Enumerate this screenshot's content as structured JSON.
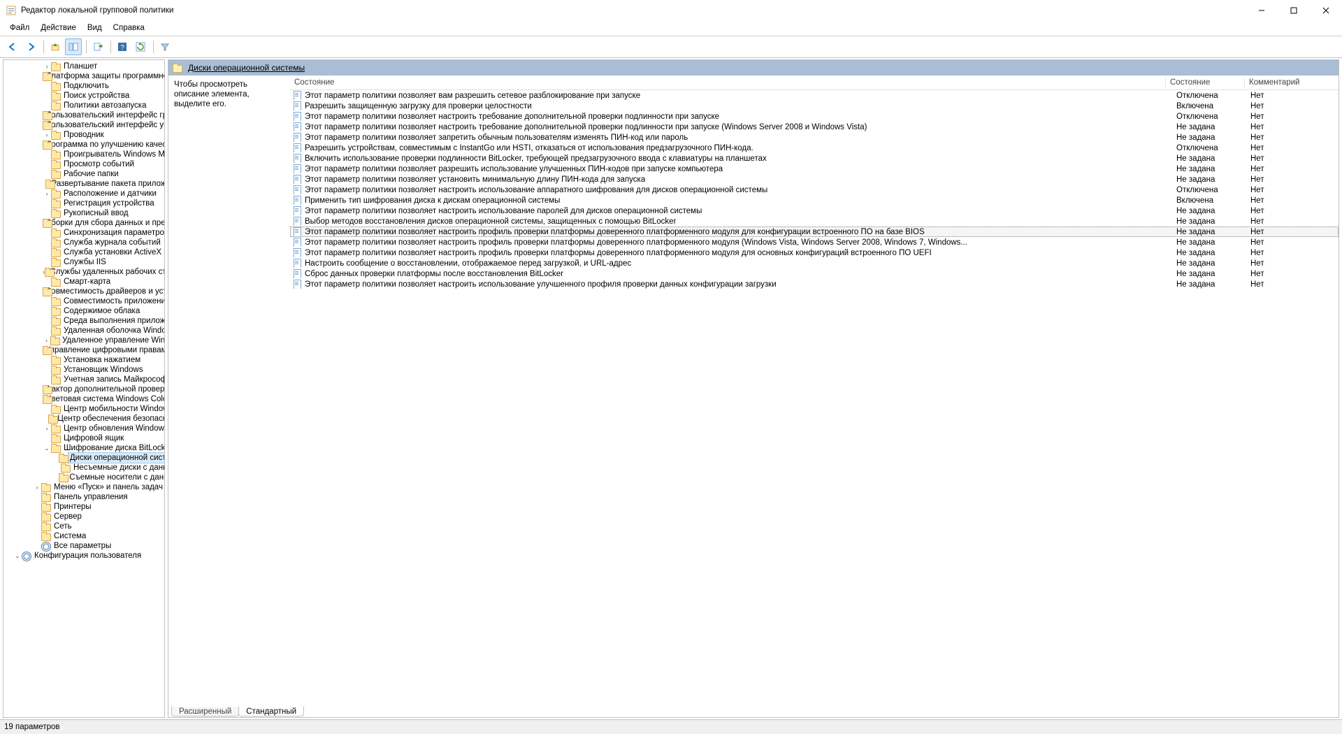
{
  "window": {
    "title": "Редактор локальной групповой политики"
  },
  "menu": {
    "file": "Файл",
    "action": "Действие",
    "view": "Вид",
    "help": "Справка"
  },
  "detail": {
    "title": "Диски операционной системы",
    "hint": "Чтобы просмотреть описание элемента, выделите его."
  },
  "columns": {
    "setting": "Состояние",
    "state": "Состояние",
    "comment": "Комментарий"
  },
  "tabs": {
    "extended": "Расширенный",
    "standard": "Стандартный"
  },
  "status": "19 параметров",
  "selected_index": 13,
  "tree": [
    {
      "l": 4,
      "t": "closed",
      "text": "Планшет"
    },
    {
      "l": 4,
      "t": "none",
      "text": "Платформа защиты программного обеспечения"
    },
    {
      "l": 4,
      "t": "none",
      "text": "Подключить"
    },
    {
      "l": 4,
      "t": "none",
      "text": "Поиск устройства"
    },
    {
      "l": 4,
      "t": "none",
      "text": "Политики автозапуска"
    },
    {
      "l": 4,
      "t": "none",
      "text": "Пользовательский интерфейс граничного сервера"
    },
    {
      "l": 4,
      "t": "none",
      "text": "Пользовательский интерфейс учетных данных"
    },
    {
      "l": 4,
      "t": "closed",
      "text": "Проводник"
    },
    {
      "l": 4,
      "t": "none",
      "text": "Программа по улучшению качества ПО"
    },
    {
      "l": 4,
      "t": "none",
      "text": "Проигрыватель Windows Media"
    },
    {
      "l": 4,
      "t": "none",
      "text": "Просмотр событий"
    },
    {
      "l": 4,
      "t": "none",
      "text": "Рабочие папки"
    },
    {
      "l": 4,
      "t": "none",
      "text": "Развертывание пакета приложения"
    },
    {
      "l": 4,
      "t": "closed",
      "text": "Расположение и датчики"
    },
    {
      "l": 4,
      "t": "none",
      "text": "Регистрация устройства"
    },
    {
      "l": 4,
      "t": "none",
      "text": "Рукописный ввод"
    },
    {
      "l": 4,
      "t": "none",
      "text": "Сборки для сбора данных и предварительных версий"
    },
    {
      "l": 4,
      "t": "none",
      "text": "Синхронизация параметров"
    },
    {
      "l": 4,
      "t": "none",
      "text": "Служба журнала событий"
    },
    {
      "l": 4,
      "t": "none",
      "text": "Служба установки ActiveX"
    },
    {
      "l": 4,
      "t": "none",
      "text": "Службы IIS"
    },
    {
      "l": 4,
      "t": "closed",
      "text": "Службы удаленных рабочих столов"
    },
    {
      "l": 4,
      "t": "none",
      "text": "Смарт-карта"
    },
    {
      "l": 4,
      "t": "none",
      "text": "Совместимость драйверов и устройств"
    },
    {
      "l": 4,
      "t": "none",
      "text": "Совместимость приложений"
    },
    {
      "l": 4,
      "t": "none",
      "text": "Содержимое облака"
    },
    {
      "l": 4,
      "t": "none",
      "text": "Среда выполнения приложения"
    },
    {
      "l": 4,
      "t": "none",
      "text": "Удаленная оболочка Windows"
    },
    {
      "l": 4,
      "t": "closed",
      "text": "Удаленное управление Windows"
    },
    {
      "l": 4,
      "t": "none",
      "text": "Управление цифровыми правами Windows Media"
    },
    {
      "l": 4,
      "t": "none",
      "text": "Установка нажатием"
    },
    {
      "l": 4,
      "t": "none",
      "text": "Установщик Windows"
    },
    {
      "l": 4,
      "t": "none",
      "text": "Учетная запись Майкрософт"
    },
    {
      "l": 4,
      "t": "none",
      "text": "Фактор дополнительной проверки подлинности"
    },
    {
      "l": 4,
      "t": "none",
      "text": "Цветовая система Windows Color System"
    },
    {
      "l": 4,
      "t": "none",
      "text": "Центр мобильности Windows"
    },
    {
      "l": 4,
      "t": "none",
      "text": "Центр обеспечения безопасности"
    },
    {
      "l": 4,
      "t": "closed",
      "text": "Центр обновления Windows"
    },
    {
      "l": 4,
      "t": "none",
      "text": "Цифровой ящик"
    },
    {
      "l": 4,
      "t": "open",
      "text": "Шифрование диска BitLocker"
    },
    {
      "l": 5,
      "t": "none",
      "text": "Диски операционной системы",
      "selected": true
    },
    {
      "l": 5,
      "t": "none",
      "text": "Несъемные диски с данными"
    },
    {
      "l": 5,
      "t": "none",
      "text": "Съемные носители с данными"
    },
    {
      "l": 3,
      "t": "closed",
      "text": "Меню «Пуск» и панель задач"
    },
    {
      "l": 3,
      "t": "none",
      "text": "Панель управления"
    },
    {
      "l": 3,
      "t": "none",
      "text": "Принтеры"
    },
    {
      "l": 3,
      "t": "none",
      "text": "Сервер"
    },
    {
      "l": 3,
      "t": "none",
      "text": "Сеть"
    },
    {
      "l": 3,
      "t": "none",
      "text": "Система"
    },
    {
      "l": 3,
      "t": "none",
      "text": "Все параметры",
      "icon": "gear"
    },
    {
      "l": 1,
      "t": "open",
      "text": "Конфигурация пользователя",
      "icon": "gear"
    }
  ],
  "settings": [
    {
      "name": "Этот параметр политики позволяет вам разрешить сетевое разблокирование при запуске",
      "state": "Отключена",
      "comment": "Нет"
    },
    {
      "name": "Разрешить защищенную загрузку для проверки целостности",
      "state": "Включена",
      "comment": "Нет"
    },
    {
      "name": "Этот параметр политики позволяет настроить требование дополнительной проверки подлинности при запуске",
      "state": "Отключена",
      "comment": "Нет"
    },
    {
      "name": "Этот параметр политики позволяет настроить требование дополнительной проверки подлинности при запуске (Windows Server 2008 и Windows Vista)",
      "state": "Не задана",
      "comment": "Нет"
    },
    {
      "name": "Этот параметр политики позволяет запретить обычным пользователям изменять ПИН-код или пароль",
      "state": "Не задана",
      "comment": "Нет"
    },
    {
      "name": "Разрешить устройствам, совместимым с InstantGo или HSTI, отказаться от использования предзагрузочного ПИН-кода.",
      "state": "Отключена",
      "comment": "Нет"
    },
    {
      "name": "Включить использование проверки подлинности BitLocker, требующей предзагрузочного ввода с клавиатуры на планшетах",
      "state": "Не задана",
      "comment": "Нет"
    },
    {
      "name": "Этот параметр политики позволяет разрешить использование улучшенных ПИН-кодов при запуске компьютера",
      "state": "Не задана",
      "comment": "Нет"
    },
    {
      "name": "Этот параметр политики позволяет установить минимальную длину ПИН-кода для запуска",
      "state": "Не задана",
      "comment": "Нет"
    },
    {
      "name": "Этот параметр политики позволяет настроить использование аппаратного шифрования для дисков операционной системы",
      "state": "Отключена",
      "comment": "Нет"
    },
    {
      "name": "Применить тип шифрования диска к дискам операционной системы",
      "state": "Включена",
      "comment": "Нет"
    },
    {
      "name": "Этот параметр политики позволяет настроить использование паролей для дисков операционной системы",
      "state": "Не задана",
      "comment": "Нет"
    },
    {
      "name": "Выбор методов восстановления дисков операционной системы, защищенных с помощью BitLocker",
      "state": "Не задана",
      "comment": "Нет"
    },
    {
      "name": "Этот параметр политики позволяет настроить профиль проверки платформы доверенного платформенного модуля для конфигурации встроенного ПО на базе BIOS",
      "state": "Не задана",
      "comment": "Нет"
    },
    {
      "name": "Этот параметр политики позволяет настроить профиль проверки платформы доверенного платформенного модуля (Windows Vista, Windows Server 2008, Windows 7, Windows...",
      "state": "Не задана",
      "comment": "Нет"
    },
    {
      "name": "Этот параметр политики позволяет настроить профиль проверки платформы доверенного платформенного модуля для основных конфигураций встроенного ПО UEFI",
      "state": "Не задана",
      "comment": "Нет"
    },
    {
      "name": "Настроить сообщение о восстановлении, отображаемое перед загрузкой, и URL-адрес",
      "state": "Не задана",
      "comment": "Нет"
    },
    {
      "name": "Сброс данных проверки платформы после восстановления BitLocker",
      "state": "Не задана",
      "comment": "Нет"
    },
    {
      "name": "Этот параметр политики позволяет настроить использование улучшенного профиля проверки данных конфигурации загрузки",
      "state": "Не задана",
      "comment": "Нет"
    }
  ]
}
